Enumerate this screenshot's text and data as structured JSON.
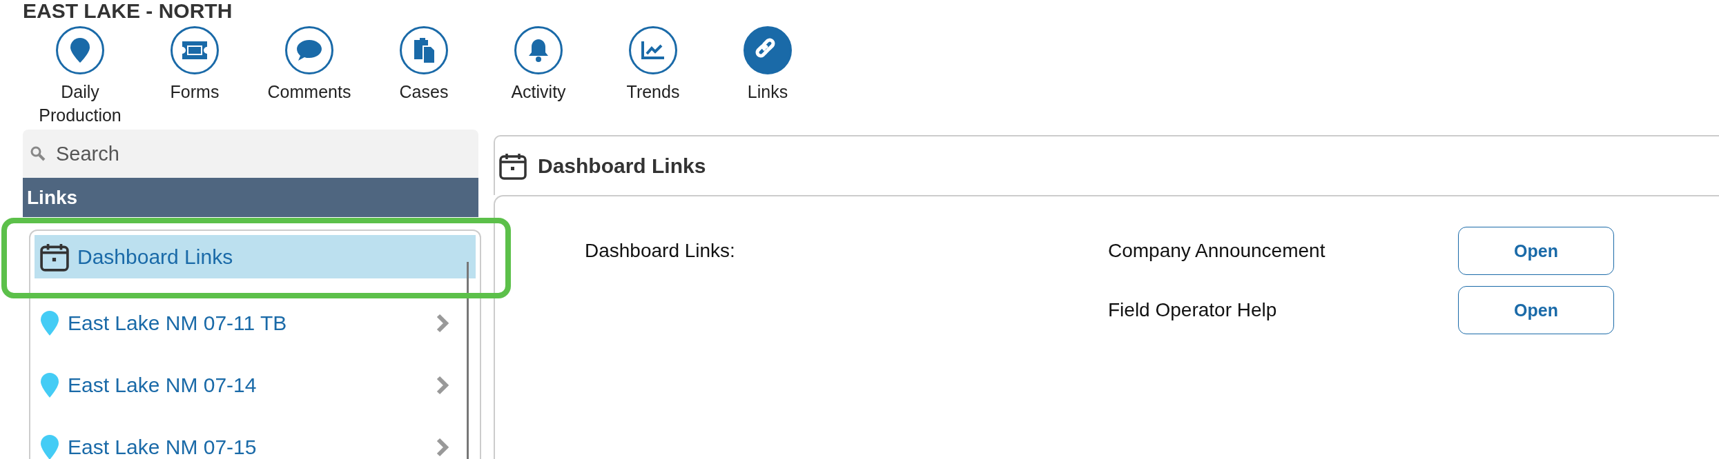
{
  "title": "EAST LAKE - NORTH",
  "nav": [
    {
      "label": "Daily Production",
      "selected": false
    },
    {
      "label": "Forms",
      "selected": false
    },
    {
      "label": "Comments",
      "selected": false
    },
    {
      "label": "Cases",
      "selected": false
    },
    {
      "label": "Activity",
      "selected": false
    },
    {
      "label": "Trends",
      "selected": false
    },
    {
      "label": "Links",
      "selected": true
    }
  ],
  "sidebar": {
    "search": {
      "placeholder": "Search"
    },
    "header": "Links",
    "items": [
      {
        "kind": "dashboard",
        "label": "Dashboard Links",
        "selected": true,
        "highlighted": true
      },
      {
        "kind": "site",
        "label": "East Lake NM 07-11 TB",
        "selected": false,
        "highlighted": false
      },
      {
        "kind": "site",
        "label": "East Lake NM 07-14",
        "selected": false,
        "highlighted": false
      },
      {
        "kind": "site",
        "label": "East Lake NM 07-15",
        "selected": false,
        "highlighted": false
      }
    ]
  },
  "main": {
    "title": "Dashboard Links",
    "section_label": "Dashboard Links:",
    "links": [
      {
        "name": "Company Announcement",
        "button": "Open"
      },
      {
        "name": "Field Operator Help",
        "button": "Open"
      }
    ]
  }
}
